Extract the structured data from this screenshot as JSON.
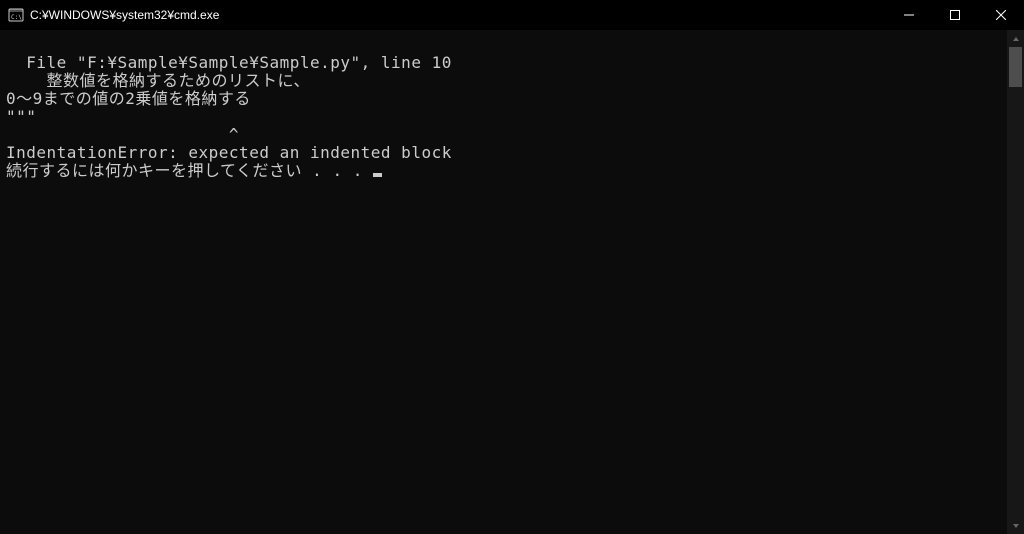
{
  "window": {
    "title": "C:¥WINDOWS¥system32¥cmd.exe"
  },
  "terminal": {
    "line1": "  File \"F:¥Sample¥Sample¥Sample.py\", line 10",
    "line2": "    整数値を格納するためのリストに、",
    "line3": "0～9までの値の2乗値を格納する",
    "line4": "\"\"\"",
    "line5": "                      ^",
    "line6": "IndentationError: expected an indented block",
    "line7": "続行するには何かキーを押してください . . . "
  }
}
